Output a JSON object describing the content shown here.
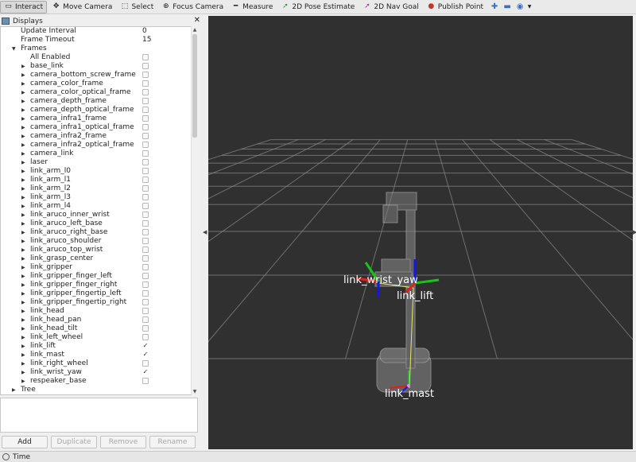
{
  "toolbar": {
    "interact": "Interact",
    "move_camera": "Move Camera",
    "select": "Select",
    "focus_camera": "Focus Camera",
    "measure": "Measure",
    "pose_estimate": "2D Pose Estimate",
    "nav_goal": "2D Nav Goal",
    "publish_point": "Publish Point"
  },
  "displays": {
    "title": "Displays",
    "update_interval_label": "Update Interval",
    "update_interval_value": "0",
    "frame_timeout_label": "Frame Timeout",
    "frame_timeout_value": "15",
    "frames_label": "Frames",
    "all_enabled_label": "All Enabled",
    "frames": [
      {
        "label": "base_link",
        "checked": false
      },
      {
        "label": "camera_bottom_screw_frame",
        "checked": false
      },
      {
        "label": "camera_color_frame",
        "checked": false
      },
      {
        "label": "camera_color_optical_frame",
        "checked": false
      },
      {
        "label": "camera_depth_frame",
        "checked": false
      },
      {
        "label": "camera_depth_optical_frame",
        "checked": false
      },
      {
        "label": "camera_infra1_frame",
        "checked": false
      },
      {
        "label": "camera_infra1_optical_frame",
        "checked": false
      },
      {
        "label": "camera_infra2_frame",
        "checked": false
      },
      {
        "label": "camera_infra2_optical_frame",
        "checked": false
      },
      {
        "label": "camera_link",
        "checked": false
      },
      {
        "label": "laser",
        "checked": false
      },
      {
        "label": "link_arm_l0",
        "checked": false
      },
      {
        "label": "link_arm_l1",
        "checked": false
      },
      {
        "label": "link_arm_l2",
        "checked": false
      },
      {
        "label": "link_arm_l3",
        "checked": false
      },
      {
        "label": "link_arm_l4",
        "checked": false
      },
      {
        "label": "link_aruco_inner_wrist",
        "checked": false
      },
      {
        "label": "link_aruco_left_base",
        "checked": false
      },
      {
        "label": "link_aruco_right_base",
        "checked": false
      },
      {
        "label": "link_aruco_shoulder",
        "checked": false
      },
      {
        "label": "link_aruco_top_wrist",
        "checked": false
      },
      {
        "label": "link_grasp_center",
        "checked": false
      },
      {
        "label": "link_gripper",
        "checked": false
      },
      {
        "label": "link_gripper_finger_left",
        "checked": false
      },
      {
        "label": "link_gripper_finger_right",
        "checked": false
      },
      {
        "label": "link_gripper_fingertip_left",
        "checked": false
      },
      {
        "label": "link_gripper_fingertip_right",
        "checked": false
      },
      {
        "label": "link_head",
        "checked": false
      },
      {
        "label": "link_head_pan",
        "checked": false
      },
      {
        "label": "link_head_tilt",
        "checked": false
      },
      {
        "label": "link_left_wheel",
        "checked": false
      },
      {
        "label": "link_lift",
        "checked": true
      },
      {
        "label": "link_mast",
        "checked": true
      },
      {
        "label": "link_right_wheel",
        "checked": false
      },
      {
        "label": "link_wrist_yaw",
        "checked": true
      },
      {
        "label": "respeaker_base",
        "checked": false
      }
    ],
    "tree_label": "Tree",
    "check_mark": "✓"
  },
  "buttons": {
    "add": "Add",
    "duplicate": "Duplicate",
    "remove": "Remove",
    "rename": "Rename"
  },
  "viewport": {
    "frame_labels": {
      "wrist_yaw": "link_wrist_yaw",
      "lift": "link_lift",
      "mast": "link_mast"
    }
  },
  "time_panel": {
    "title": "Time"
  },
  "colors": {
    "viewport_bg": "#303030",
    "grid": "#8a8a8a",
    "axis_x": "#e0201a",
    "axis_y": "#19c419",
    "axis_z": "#1717e0",
    "tf_link": "#e8e86a"
  }
}
